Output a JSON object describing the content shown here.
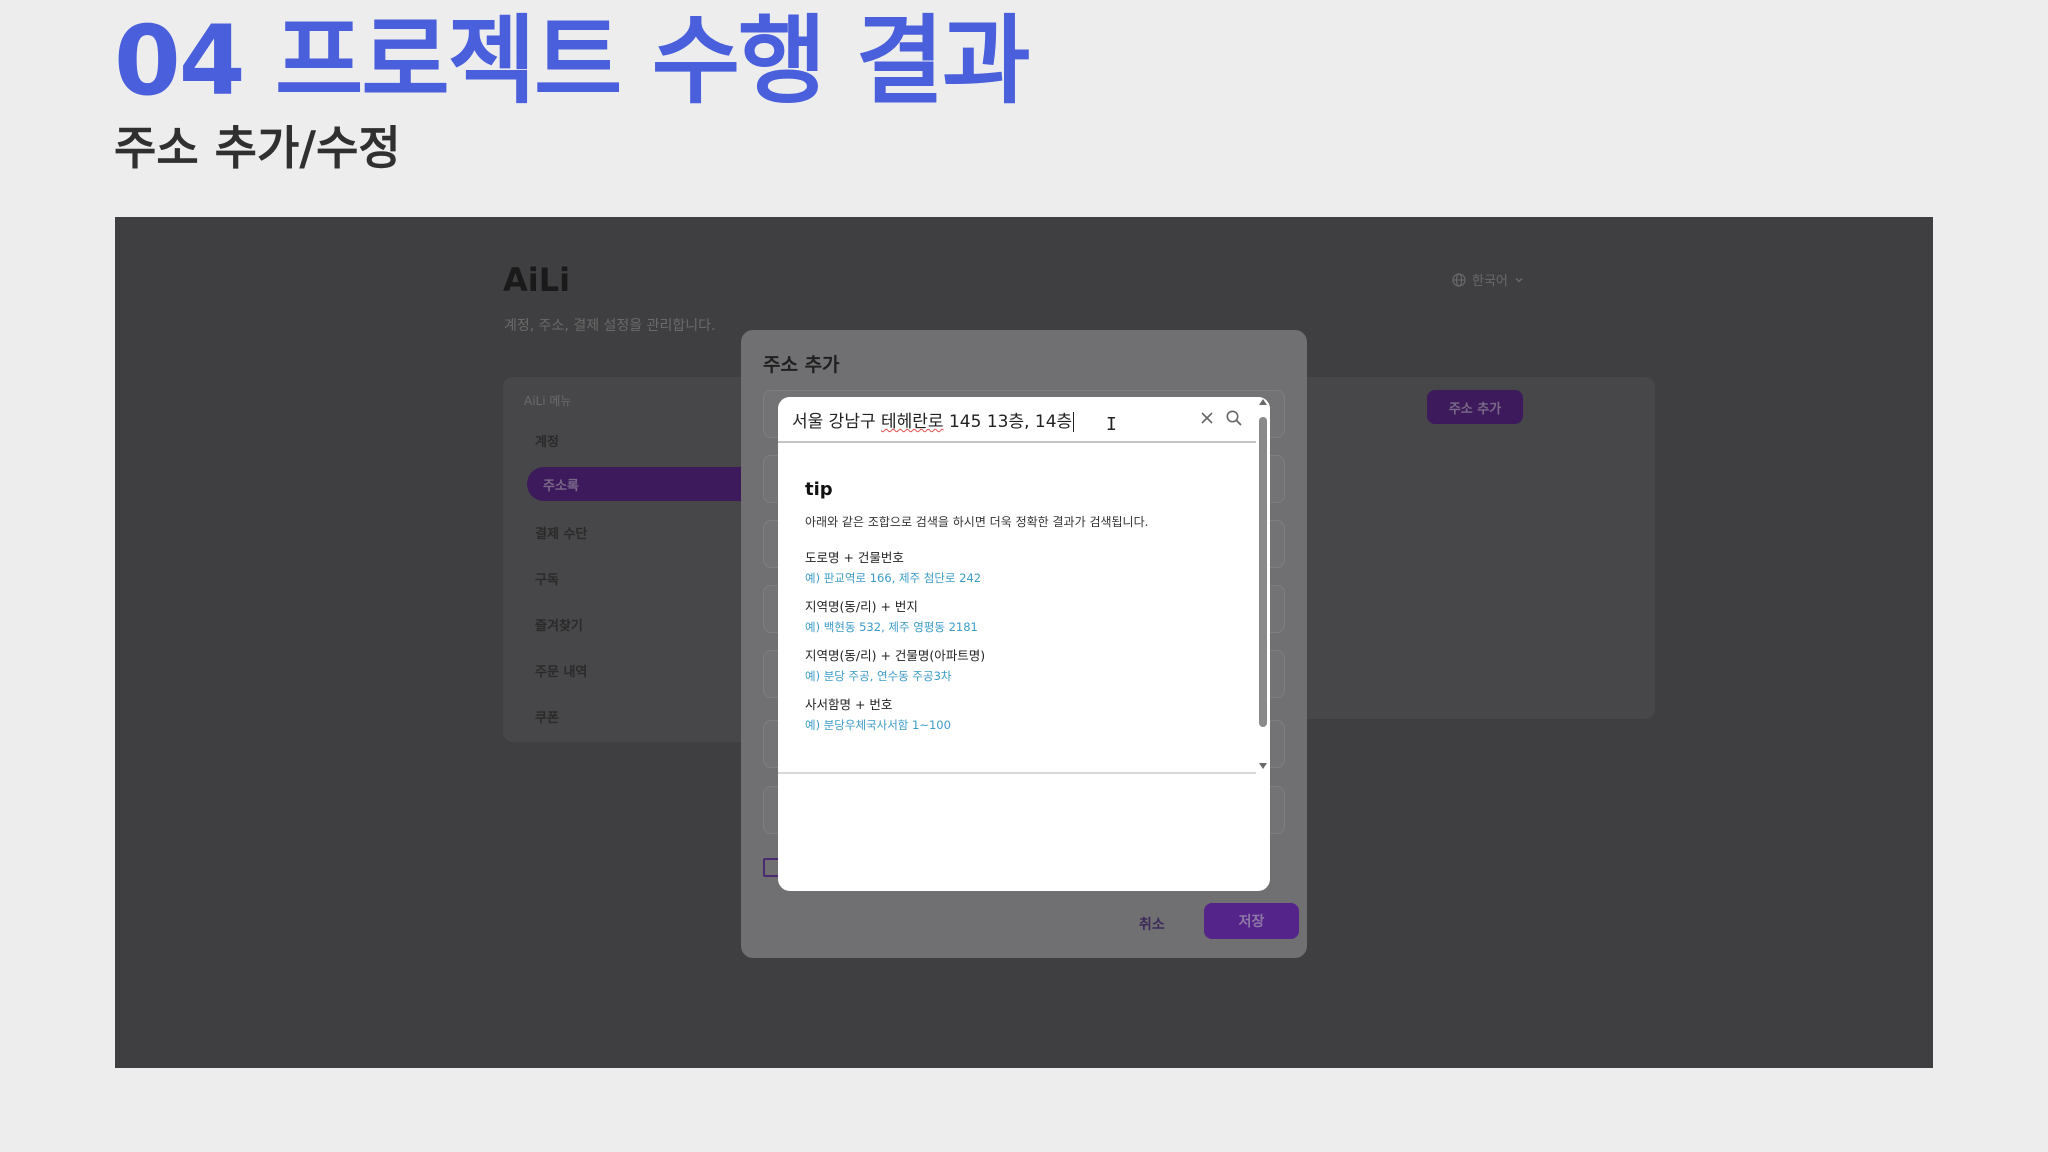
{
  "slide": {
    "title": "04 프로젝트 수행 결과",
    "subtitle": "주소 추가/수정"
  },
  "app": {
    "brand": "AiLi",
    "description": "계정, 주소, 결제 설정을 관리합니다.",
    "language": "한국어",
    "sidebar": {
      "heading": "AiLi 메뉴",
      "items": [
        {
          "label": "계정"
        },
        {
          "label": "주소록",
          "active": true
        },
        {
          "label": "결제 수단"
        },
        {
          "label": "구독"
        },
        {
          "label": "즐겨찾기"
        },
        {
          "label": "주문 내역"
        },
        {
          "label": "쿠폰"
        }
      ]
    },
    "add_address_button": "주소 추가"
  },
  "modal": {
    "title": "주소 추가",
    "cancel_label": "취소",
    "save_label": "저장"
  },
  "search_popup": {
    "query_prefix": "서울 강남구 ",
    "query_misspelled": "테헤란로",
    "query_suffix": " 145 13층, 14층",
    "tip": {
      "title": "tip",
      "description": "아래와 같은 조합으로 검색을 하시면 더욱 정확한 결과가 검색됩니다.",
      "items": [
        {
          "title": "도로명 + 건물번호",
          "example": "예) 판교역로 166,  제주 첨단로 242"
        },
        {
          "title": "지역명(동/리) + 번지",
          "example": "예) 백현동 532,  제주 영평동 2181"
        },
        {
          "title": "지역명(동/리) + 건물명(아파트명)",
          "example": "예) 분당 주공,  연수동 주공3차"
        },
        {
          "title": "사서함명 + 번호",
          "example": "예) 분당우체국사서함 1~100"
        }
      ]
    }
  },
  "colors": {
    "title_blue": "#4a5fdb",
    "accent_purple": "#54248a",
    "example_blue": "#3c9bc7"
  }
}
